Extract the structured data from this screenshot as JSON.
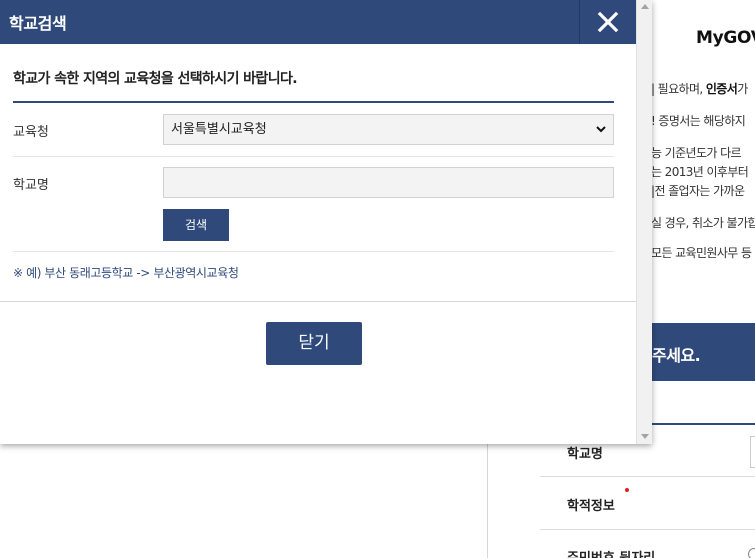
{
  "popup": {
    "title": "학교검색",
    "close_icon": "close-icon",
    "instruction": "학교가 속한 지역의 교육청을 선택하시기 바랍니다.",
    "office_label": "교육청",
    "office_selected": "서울특별시교육청",
    "school_label": "학교명",
    "school_value": "",
    "search_button": "검색",
    "example_note": "※ 예) 부산 동래고등학교 -> 부산광역시교육청",
    "close_button": "닫기"
  },
  "background": {
    "logo_text": "MyGOV",
    "notices": [
      {
        "pre": "| 필요하며, ",
        "bold": "인증서",
        "post": "가"
      },
      {
        "pre": "! 증명서는 해당하지",
        "bold": "",
        "post": ""
      },
      {
        "pre": "능 기준년도가 다르",
        "bold": "",
        "post": ""
      },
      {
        "pre": "는 2013년 이후부터",
        "bold": "",
        "post": ""
      },
      {
        "pre": "|전 졸업자는 가까운",
        "bold": "",
        "post": ""
      },
      {
        "pre": "실 경우, 취소가 불가합",
        "bold": "",
        "post": ""
      },
      {
        "pre": "모든 교육민원사무 등",
        "bold": "",
        "post": ""
      }
    ],
    "banner_text": "주세요.",
    "rows": [
      "학교명",
      "학적정보",
      "주민번호 뒷자리"
    ]
  },
  "colors": {
    "brand_navy": "#2f4a7a",
    "required_dot": "#e02020"
  }
}
